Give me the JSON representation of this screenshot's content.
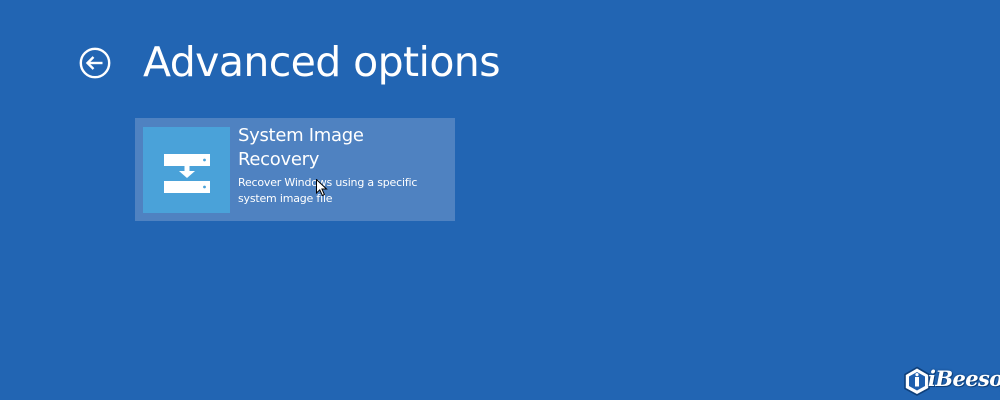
{
  "header": {
    "back_icon": "back-arrow-circle-icon",
    "title": "Advanced options"
  },
  "options": [
    {
      "icon": "system-image-recovery-icon",
      "title": "System Image Recovery",
      "description": "Recover Windows using a specific system image file"
    }
  ],
  "watermark": {
    "logo_icon": "ibeesoft-logo-icon",
    "text": "iBeesoft"
  },
  "colors": {
    "background": "#2265b3",
    "tile_background": "#4f82c1",
    "icon_background": "#4aa2d9",
    "text": "#ffffff"
  }
}
